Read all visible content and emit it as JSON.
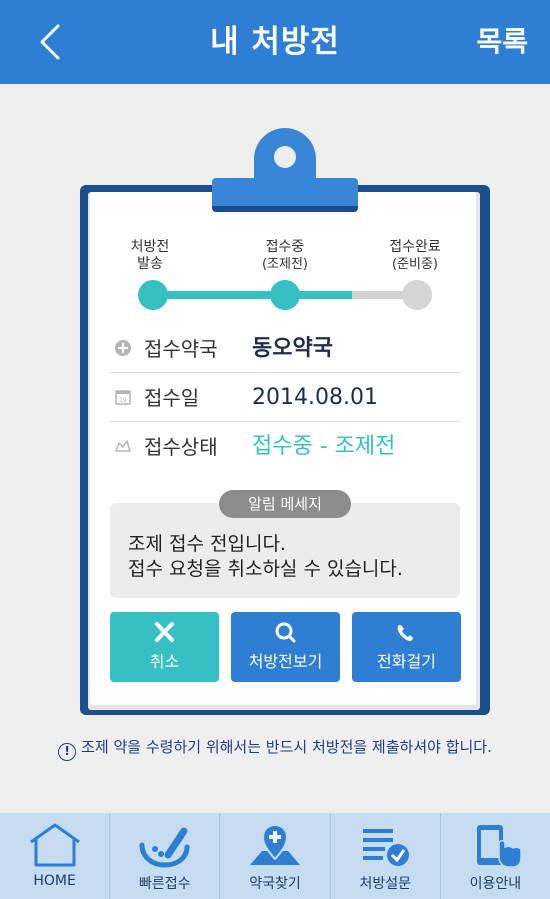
{
  "header": {
    "title": "내 처방전",
    "list_label": "목록"
  },
  "progress": {
    "steps": [
      {
        "line1": "처방전",
        "line2": "발송",
        "status": "done"
      },
      {
        "line1": "접수중",
        "line2": "(조제전)",
        "status": "current"
      },
      {
        "line1": "접수완료",
        "line2": "(준비중)",
        "status": "pending"
      }
    ],
    "fill_fraction": 0.75
  },
  "info": {
    "pharmacy_label": "접수약국",
    "pharmacy_value": "동오약국",
    "date_label": "접수일",
    "date_value": "2014.08.01",
    "status_label": "접수상태",
    "status_value": "접수중 - 조제전"
  },
  "message": {
    "badge": "알림 메세지",
    "line1": "조제 접수 전입니다.",
    "line2": "접수 요청을 취소하실 수 있습니다."
  },
  "actions": {
    "cancel": "취소",
    "view": "처방전보기",
    "call": "전화걸기"
  },
  "notice": {
    "icon": "!",
    "text": "조제 약을 수령하기 위해서는 반드시 처방전을 제출하셔야 합니다."
  },
  "nav": [
    {
      "label": "HOME",
      "icon": "home-icon"
    },
    {
      "label": "빠른접수",
      "icon": "fast-receipt-icon"
    },
    {
      "label": "약국찾기",
      "icon": "pharmacy-map-icon"
    },
    {
      "label": "처방설문",
      "icon": "survey-icon"
    },
    {
      "label": "이용안내",
      "icon": "guide-icon"
    }
  ],
  "colors": {
    "primary": "#2e7fd4",
    "accent": "#37c0c4",
    "nav_bg": "#c6dcf0",
    "text_dark": "#1f2d4a"
  }
}
